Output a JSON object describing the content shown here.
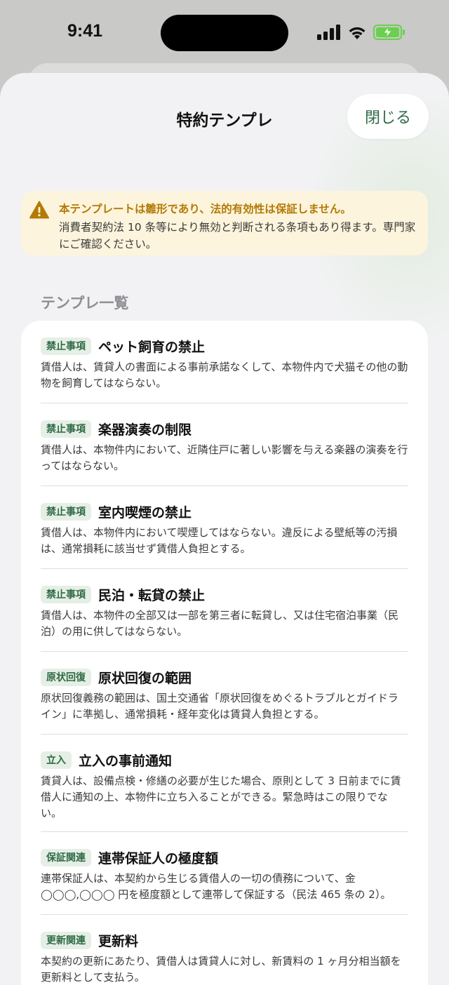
{
  "status_bar": {
    "time": "9:41"
  },
  "sheet": {
    "title": "特約テンプレ",
    "close_label": "閉じる"
  },
  "warning": {
    "title": "本テンプレートは雛形であり、法的有効性は保証しません。",
    "body": "消費者契約法 10 条等により無効と判断される条項もあり得ます。専門家にご確認ください。"
  },
  "section_label": "テンプレ一覧",
  "templates": [
    {
      "tag": "禁止事項",
      "title": "ペット飼育の禁止",
      "body": "賃借人は、賃貸人の書面による事前承諾なくして、本物件内で犬猫その他の動物を飼育してはならない。"
    },
    {
      "tag": "禁止事項",
      "title": "楽器演奏の制限",
      "body": "賃借人は、本物件内において、近隣住戸に著しい影響を与える楽器の演奏を行ってはならない。"
    },
    {
      "tag": "禁止事項",
      "title": "室内喫煙の禁止",
      "body": "賃借人は、本物件内において喫煙してはならない。違反による壁紙等の汚損は、通常損耗に該当せず賃借人負担とする。"
    },
    {
      "tag": "禁止事項",
      "title": "民泊・転貸の禁止",
      "body": "賃借人は、本物件の全部又は一部を第三者に転貸し、又は住宅宿泊事業（民泊）の用に供してはならない。"
    },
    {
      "tag": "原状回復",
      "title": "原状回復の範囲",
      "body": "原状回復義務の範囲は、国土交通省「原状回復をめぐるトラブルとガイドライン」に準拠し、通常損耗・経年変化は賃貸人負担とする。"
    },
    {
      "tag": "立入",
      "title": "立入の事前通知",
      "body": "賃貸人は、設備点検・修繕の必要が生じた場合、原則として 3 日前までに賃借人に通知の上、本物件に立ち入ることができる。緊急時はこの限りでない。"
    },
    {
      "tag": "保証関連",
      "title": "連帯保証人の極度額",
      "body": "連帯保証人は、本契約から生じる賃借人の一切の債務について、金 ◯◯◯,◯◯◯ 円を極度額として連帯して保証する（民法 465 条の 2）。"
    },
    {
      "tag": "更新関連",
      "title": "更新料",
      "body": "本契約の更新にあたり、賃借人は賃貸人に対し、新賃料の 1 ヶ月分相当額を更新料として支払う。"
    }
  ]
}
